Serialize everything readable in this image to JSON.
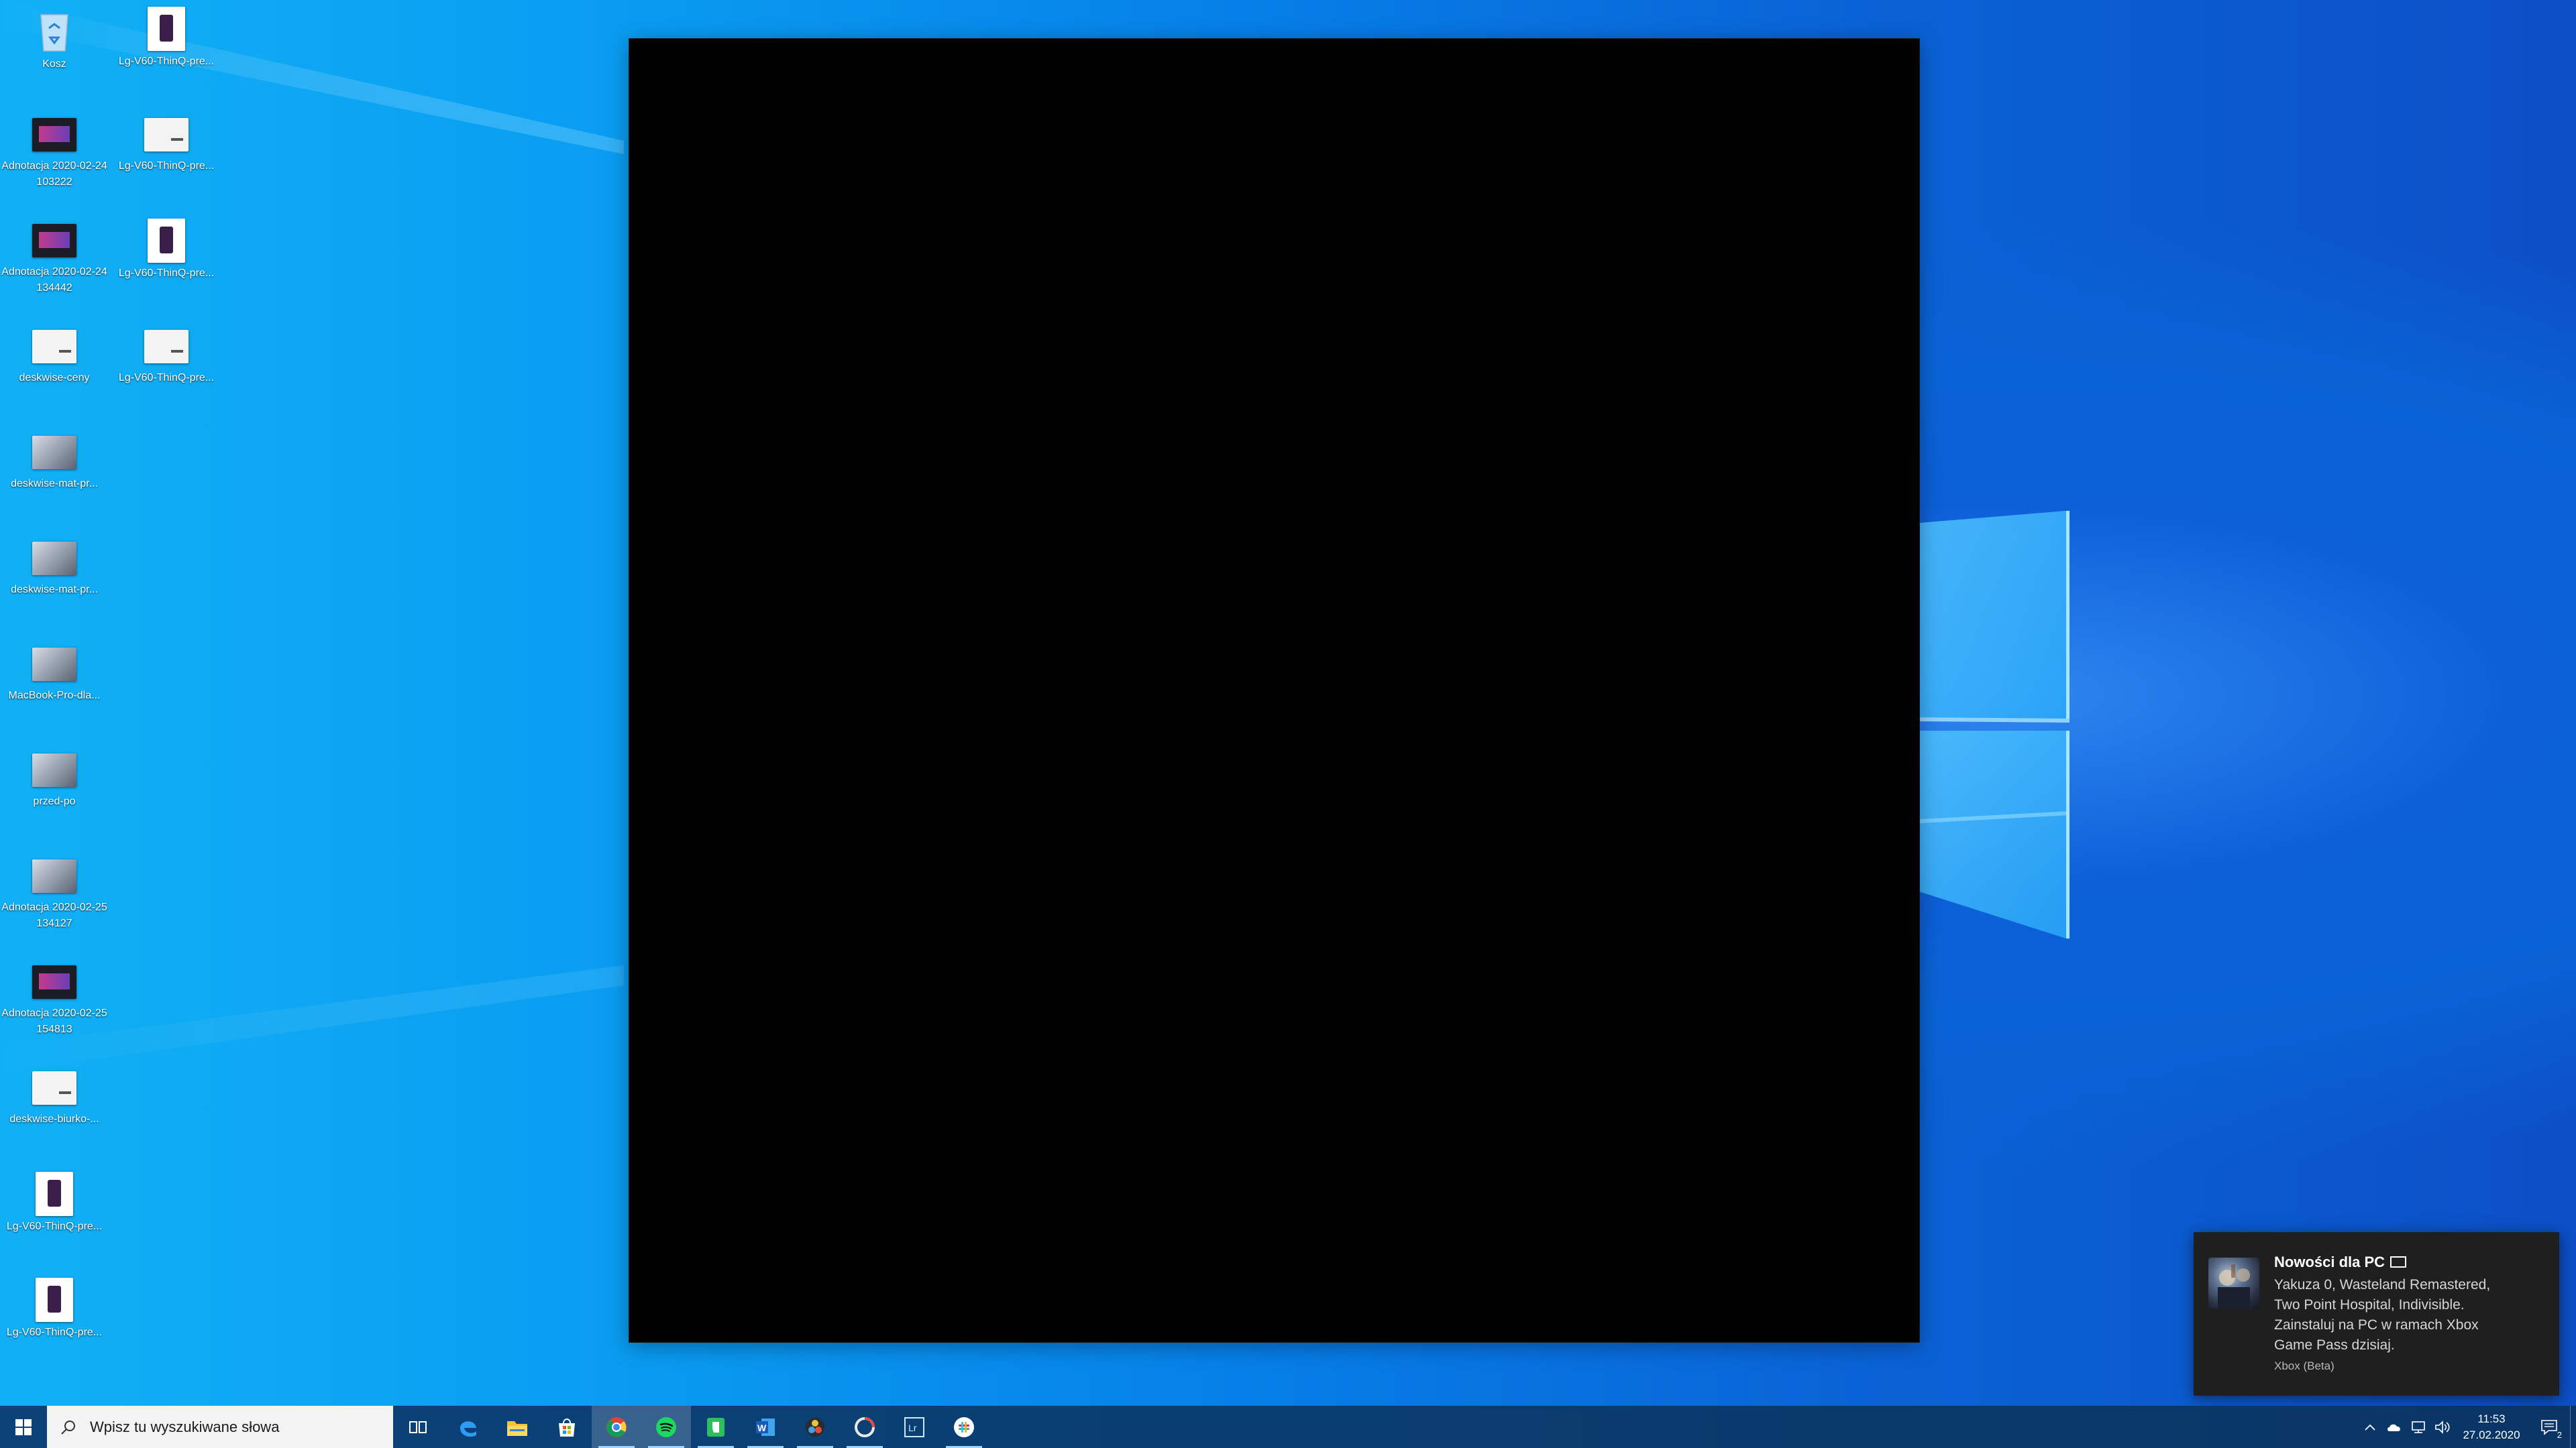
{
  "desktop": {
    "icons": [
      {
        "label": "Kosz",
        "kind": "recycle-bin"
      },
      {
        "label": "Lg-V60-ThinQ-pre...",
        "kind": "image"
      },
      {
        "label": "Adnotacja 2020-02-24 103222",
        "kind": "image"
      },
      {
        "label": "Lg-V60-ThinQ-pre...",
        "kind": "image"
      },
      {
        "label": "Adnotacja 2020-02-24 134442",
        "kind": "image"
      },
      {
        "label": "Lg-V60-ThinQ-pre...",
        "kind": "image"
      },
      {
        "label": "deskwise-ceny",
        "kind": "image"
      },
      {
        "label": "Lg-V60-ThinQ-pre...",
        "kind": "image"
      },
      {
        "label": "deskwise-mat-pr...",
        "kind": "image"
      },
      {
        "label": "deskwise-mat-pr...",
        "kind": "image"
      },
      {
        "label": "MacBook-Pro-dla...",
        "kind": "image"
      },
      {
        "label": "przed-po",
        "kind": "image"
      },
      {
        "label": "Adnotacja 2020-02-25 134127",
        "kind": "image"
      },
      {
        "label": "Adnotacja 2020-02-25 154813",
        "kind": "image"
      },
      {
        "label": "deskwise-biurko-...",
        "kind": "image"
      },
      {
        "label": "Lg-V60-ThinQ-pre...",
        "kind": "image"
      },
      {
        "label": "Lg-V60-ThinQ-pre...",
        "kind": "image"
      }
    ]
  },
  "notification": {
    "title": "Nowości dla PC",
    "body": "Yakuza 0, Wasteland Remastered, Two Point Hospital, Indivisible. Zainstaluj na PC w ramach Xbox Game Pass dzisiaj.",
    "source": "Xbox (Beta)",
    "icon": "pc-icon"
  },
  "taskbar": {
    "search_placeholder": "Wpisz tu wyszukiwane słowa",
    "apps": [
      {
        "name": "task-view-icon"
      },
      {
        "name": "edge-icon"
      },
      {
        "name": "file-explorer-icon"
      },
      {
        "name": "store-icon"
      },
      {
        "name": "chrome-icon"
      },
      {
        "name": "spotify-icon"
      },
      {
        "name": "evernote-icon"
      },
      {
        "name": "word-icon"
      },
      {
        "name": "davinci-resolve-icon"
      },
      {
        "name": "lightroom-classic-icon"
      },
      {
        "name": "lightroom-icon"
      },
      {
        "name": "slack-icon"
      }
    ],
    "clock": {
      "time": "11:53",
      "date": "27.02.2020"
    },
    "notification_count": "2"
  },
  "colors": {
    "accent": "#0a78e0",
    "taskbar": "#0b4278",
    "toast_bg": "#1f1f1f"
  }
}
